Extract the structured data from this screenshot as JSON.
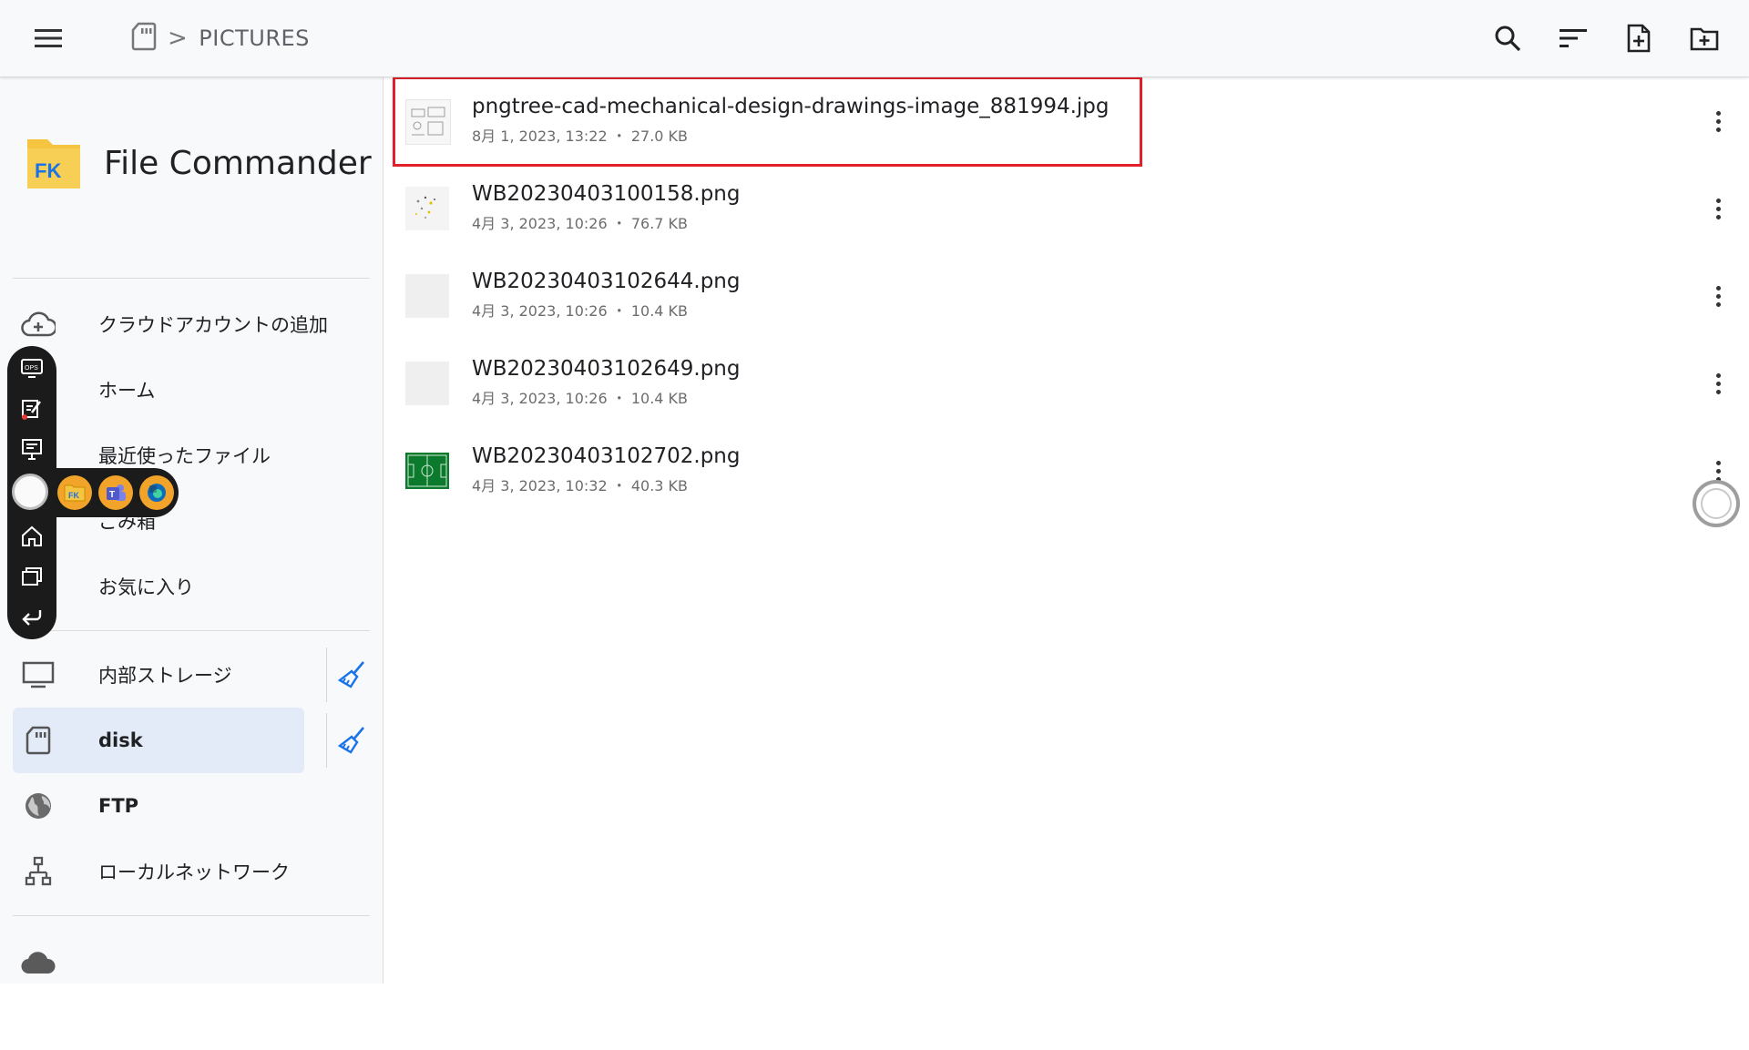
{
  "topbar": {
    "crumb_separator": ">",
    "crumb_current": "PICTURES",
    "icons": [
      "menu-icon",
      "sd-card-icon",
      "search-icon",
      "sort-icon",
      "new-file-icon",
      "new-folder-icon"
    ]
  },
  "sidebar": {
    "app_title": "File Commander",
    "logo_text": "FK",
    "items": [
      {
        "label": "クラウドアカウントの追加",
        "icon": "cloud-add-icon"
      },
      {
        "label": "ホーム",
        "icon": "home-icon"
      },
      {
        "label": "最近使ったファイル",
        "icon": "recent-icon"
      },
      {
        "label": "ごみ箱",
        "icon": "trash-icon"
      },
      {
        "label": "お気に入り",
        "icon": "star-icon"
      }
    ],
    "storage": [
      {
        "label": "内部ストレージ",
        "icon": "monitor-icon"
      },
      {
        "label": "disk",
        "icon": "sd-card-icon",
        "selected": true
      },
      {
        "label": "FTP",
        "icon": "globe-icon"
      },
      {
        "label": "ローカルネットワーク",
        "icon": "network-icon"
      }
    ]
  },
  "dock": {
    "ops_label": "OPS",
    "buttons": [
      "ops-icon",
      "edit-icon",
      "whiteboard-icon",
      "home-icon",
      "windows-icon",
      "back-icon"
    ],
    "apps": [
      "file-commander-app-icon",
      "teams-app-icon",
      "browser-app-icon"
    ]
  },
  "files": [
    {
      "name": "pngtree-cad-mechanical-design-drawings-image_881994.jpg",
      "date": "8月 1, 2023, 13:22",
      "size": "27.0 KB",
      "thumb": "cad"
    },
    {
      "name": "WB20230403100158.png",
      "date": "4月 3, 2023, 10:26",
      "size": "76.7 KB",
      "thumb": "dots"
    },
    {
      "name": "WB20230403102644.png",
      "date": "4月 3, 2023, 10:26",
      "size": "10.4 KB",
      "thumb": "blank"
    },
    {
      "name": "WB20230403102649.png",
      "date": "4月 3, 2023, 10:26",
      "size": "10.4 KB",
      "thumb": "blank"
    },
    {
      "name": "WB20230403102702.png",
      "date": "4月 3, 2023, 10:32",
      "size": "40.3 KB",
      "thumb": "field"
    }
  ],
  "meta_separator": "・",
  "colors": {
    "accent": "#1a73e8",
    "highlight": "#e0202a",
    "selected_bg": "#e2ebf7",
    "folder_yellow": "#f5c542"
  }
}
